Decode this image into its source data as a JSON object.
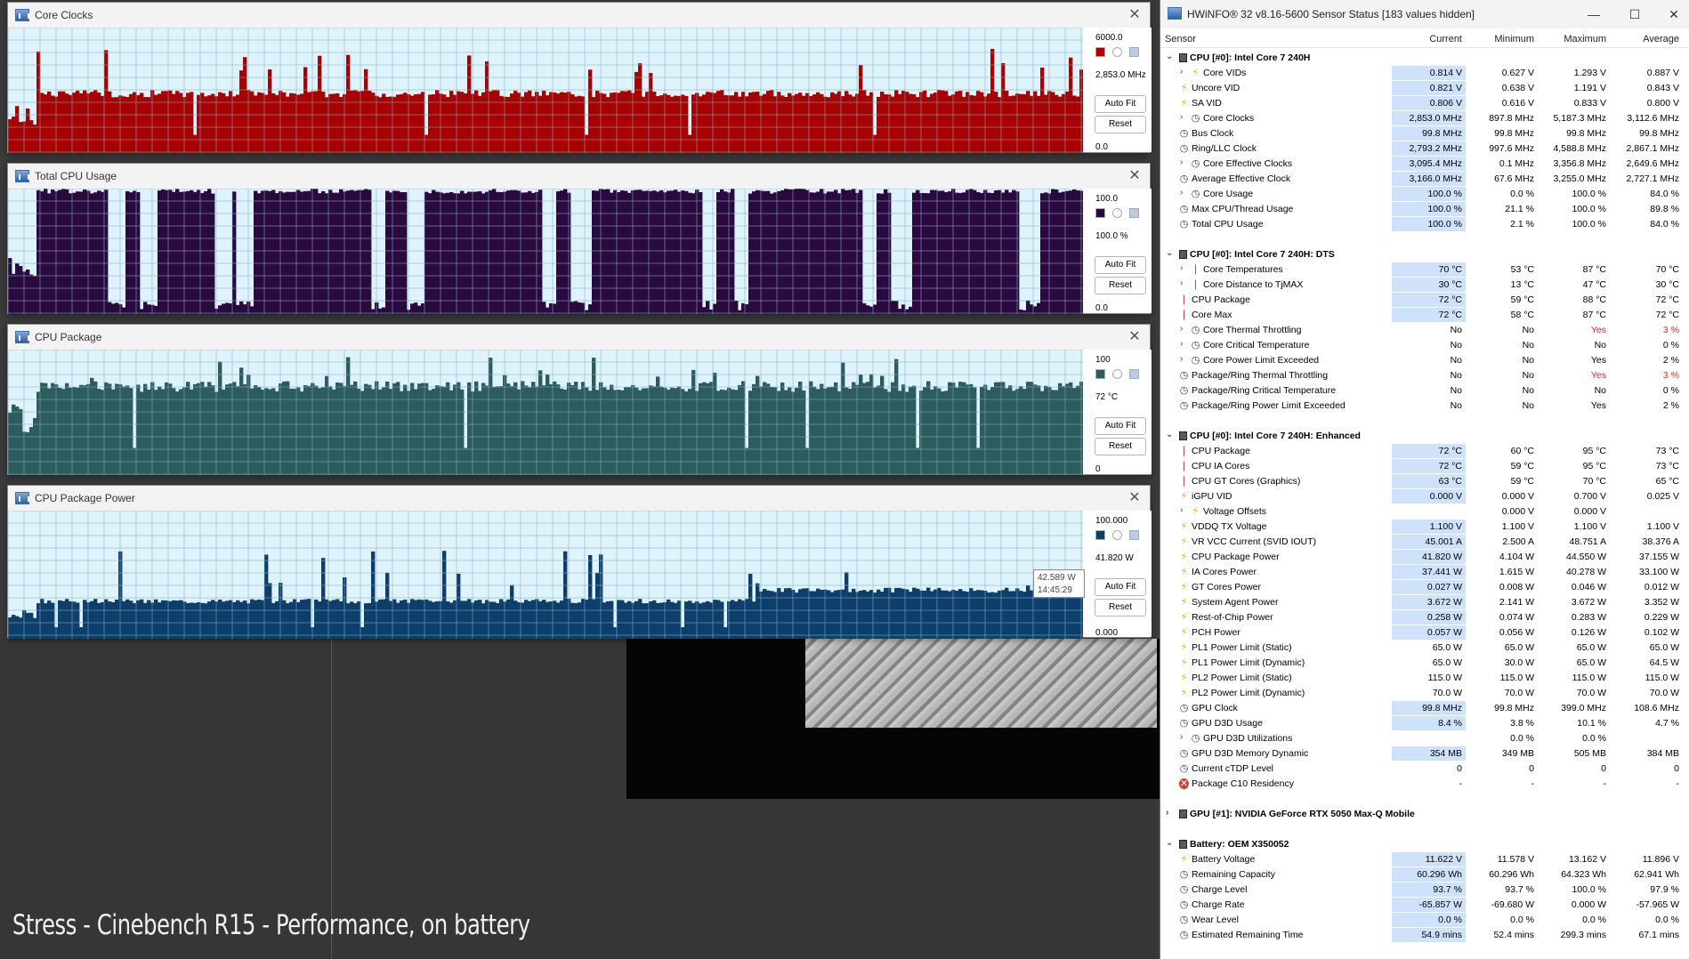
{
  "graph_windows": [
    {
      "title": "Core Clocks",
      "max_label": "6000.0",
      "current_label": "2,853.0 MHz",
      "min_label": "0.0",
      "color": "#a80000",
      "ymax": 6000,
      "baseline": 2900,
      "peaks": [
        4400,
        5000,
        4300,
        4200,
        5187
      ],
      "buttons": {
        "auto_fit": "Auto Fit",
        "reset": "Reset"
      }
    },
    {
      "title": "Total CPU Usage",
      "max_label": "100.0",
      "current_label": "100.0 %",
      "min_label": "0.0",
      "color": "#2a0a3e",
      "ymax": 100,
      "baseline": 98,
      "peaks": [
        100,
        100,
        100,
        100,
        100
      ],
      "buttons": {
        "auto_fit": "Auto Fit",
        "reset": "Reset"
      }
    },
    {
      "title": "CPU Package",
      "max_label": "100",
      "current_label": "72 °C",
      "min_label": "0",
      "color": "#2c5c5c",
      "ymax": 100,
      "baseline": 72,
      "peaks": [
        87,
        86,
        82,
        80,
        95
      ],
      "buttons": {
        "auto_fit": "Auto Fit",
        "reset": "Reset"
      }
    },
    {
      "title": "CPU Package Power",
      "max_label": "100.000",
      "current_label": "41.820 W",
      "min_label": "0.000",
      "color": "#0e3e6a",
      "ymax": 100,
      "baseline": 30,
      "peaks": [
        70,
        70,
        52,
        55,
        44.55
      ],
      "buttons": {
        "auto_fit": "Auto Fit",
        "reset": "Reset"
      }
    }
  ],
  "tooltip": {
    "value": "42.589 W",
    "time": "14:45:29"
  },
  "caption": "Stress - Cinebench R15 - Performance, on battery",
  "hwinfo": {
    "title": "HWiNFO® 32 v8.16-5600 Sensor Status [183 values hidden]",
    "window_buttons": {
      "minimize": "—",
      "maximize": "☐",
      "close": "✕"
    },
    "columns": [
      "Sensor",
      "Current",
      "Minimum",
      "Maximum",
      "Average"
    ],
    "groups": [
      {
        "name": "CPU [#0]: Intel Core 7 240H",
        "rows": [
          {
            "label": "Core VIDs",
            "icon": "bolt",
            "expand": true,
            "v": [
              "0.814 V",
              "0.627 V",
              "1.293 V",
              "0.887 V"
            ]
          },
          {
            "label": "Uncore VID",
            "icon": "bolt",
            "v": [
              "0.821 V",
              "0.638 V",
              "1.191 V",
              "0.843 V"
            ]
          },
          {
            "label": "SA VID",
            "icon": "bolt",
            "v": [
              "0.806 V",
              "0.616 V",
              "0.833 V",
              "0.800 V"
            ]
          },
          {
            "label": "Core Clocks",
            "icon": "clock",
            "expand": true,
            "v": [
              "2,853.0 MHz",
              "897.8 MHz",
              "5,187.3 MHz",
              "3,112.6 MHz"
            ]
          },
          {
            "label": "Bus Clock",
            "icon": "clock",
            "v": [
              "99.8 MHz",
              "99.8 MHz",
              "99.8 MHz",
              "99.8 MHz"
            ]
          },
          {
            "label": "Ring/LLC Clock",
            "icon": "clock",
            "v": [
              "2,793.2 MHz",
              "997.6 MHz",
              "4,588.8 MHz",
              "2,867.1 MHz"
            ]
          },
          {
            "label": "Core Effective Clocks",
            "icon": "clock",
            "expand": true,
            "v": [
              "3,095.4 MHz",
              "0.1 MHz",
              "3,356.8 MHz",
              "2,649.6 MHz"
            ]
          },
          {
            "label": "Average Effective Clock",
            "icon": "clock",
            "v": [
              "3,166.0 MHz",
              "67.6 MHz",
              "3,255.0 MHz",
              "2,727.1 MHz"
            ]
          },
          {
            "label": "Core Usage",
            "icon": "clock",
            "expand": true,
            "v": [
              "100.0 %",
              "0.0 %",
              "100.0 %",
              "84.0 %"
            ]
          },
          {
            "label": "Max CPU/Thread Usage",
            "icon": "clock",
            "v": [
              "100.0 %",
              "21.1 %",
              "100.0 %",
              "89.8 %"
            ]
          },
          {
            "label": "Total CPU Usage",
            "icon": "clock",
            "v": [
              "100.0 %",
              "2.1 %",
              "100.0 %",
              "84.0 %"
            ]
          }
        ]
      },
      {
        "name": "CPU [#0]: Intel Core 7 240H: DTS",
        "rows": [
          {
            "label": "Core Temperatures",
            "icon": "therm",
            "expand": true,
            "v": [
              "70 °C",
              "53 °C",
              "87 °C",
              "70 °C"
            ]
          },
          {
            "label": "Core Distance to TjMAX",
            "icon": "therm",
            "expand": true,
            "v": [
              "30 °C",
              "13 °C",
              "47 °C",
              "30 °C"
            ]
          },
          {
            "label": "CPU Package",
            "icon": "therm",
            "v": [
              "72 °C",
              "59 °C",
              "88 °C",
              "72 °C"
            ]
          },
          {
            "label": "Core Max",
            "icon": "therm",
            "v": [
              "72 °C",
              "58 °C",
              "87 °C",
              "72 °C"
            ]
          },
          {
            "label": "Core Thermal Throttling",
            "icon": "clock",
            "expand": true,
            "nohl": true,
            "red3": true,
            "red4": true,
            "v": [
              "No",
              "No",
              "Yes",
              "3 %"
            ]
          },
          {
            "label": "Core Critical Temperature",
            "icon": "clock",
            "expand": true,
            "nohl": true,
            "v": [
              "No",
              "No",
              "No",
              "0 %"
            ]
          },
          {
            "label": "Core Power Limit Exceeded",
            "icon": "clock",
            "expand": true,
            "nohl": true,
            "v": [
              "No",
              "No",
              "Yes",
              "2 %"
            ]
          },
          {
            "label": "Package/Ring Thermal Throttling",
            "icon": "clock",
            "nohl": true,
            "red3": true,
            "red4": true,
            "v": [
              "No",
              "No",
              "Yes",
              "3 %"
            ]
          },
          {
            "label": "Package/Ring Critical Temperature",
            "icon": "clock",
            "nohl": true,
            "v": [
              "No",
              "No",
              "No",
              "0 %"
            ]
          },
          {
            "label": "Package/Ring Power Limit Exceeded",
            "icon": "clock",
            "nohl": true,
            "v": [
              "No",
              "No",
              "Yes",
              "2 %"
            ]
          }
        ]
      },
      {
        "name": "CPU [#0]: Intel Core 7 240H: Enhanced",
        "rows": [
          {
            "label": "CPU Package",
            "icon": "therm",
            "v": [
              "72 °C",
              "60 °C",
              "95 °C",
              "73 °C"
            ]
          },
          {
            "label": "CPU IA Cores",
            "icon": "therm",
            "v": [
              "72 °C",
              "59 °C",
              "95 °C",
              "73 °C"
            ]
          },
          {
            "label": "CPU GT Cores (Graphics)",
            "icon": "therm",
            "v": [
              "63 °C",
              "59 °C",
              "70 °C",
              "65 °C"
            ]
          },
          {
            "label": "iGPU VID",
            "icon": "bolt",
            "v": [
              "0.000 V",
              "0.000 V",
              "0.700 V",
              "0.025 V"
            ]
          },
          {
            "label": "Voltage Offsets",
            "icon": "bolt",
            "expand": true,
            "nohl": true,
            "v": [
              "",
              "0.000 V",
              "0.000 V",
              ""
            ]
          },
          {
            "label": "VDDQ TX Voltage",
            "icon": "bolt",
            "v": [
              "1.100 V",
              "1.100 V",
              "1.100 V",
              "1.100 V"
            ]
          },
          {
            "label": "VR VCC Current (SVID IOUT)",
            "icon": "bolt",
            "v": [
              "45.001 A",
              "2.500 A",
              "48.751 A",
              "38.376 A"
            ]
          },
          {
            "label": "CPU Package Power",
            "icon": "bolt",
            "v": [
              "41.820 W",
              "4.104 W",
              "44.550 W",
              "37.155 W"
            ]
          },
          {
            "label": "IA Cores Power",
            "icon": "bolt",
            "v": [
              "37.441 W",
              "1.615 W",
              "40.278 W",
              "33.100 W"
            ]
          },
          {
            "label": "GT Cores Power",
            "icon": "bolt",
            "v": [
              "0.027 W",
              "0.008 W",
              "0.046 W",
              "0.012 W"
            ]
          },
          {
            "label": "System Agent Power",
            "icon": "bolt",
            "v": [
              "3.672 W",
              "2.141 W",
              "3.672 W",
              "3.352 W"
            ]
          },
          {
            "label": "Rest-of-Chip Power",
            "icon": "bolt",
            "v": [
              "0.258 W",
              "0.074 W",
              "0.283 W",
              "0.229 W"
            ]
          },
          {
            "label": "PCH Power",
            "icon": "bolt",
            "v": [
              "0.057 W",
              "0.056 W",
              "0.126 W",
              "0.102 W"
            ]
          },
          {
            "label": "PL1 Power Limit (Static)",
            "icon": "bolt",
            "nohl": true,
            "v": [
              "65.0 W",
              "65.0 W",
              "65.0 W",
              "65.0 W"
            ]
          },
          {
            "label": "PL1 Power Limit (Dynamic)",
            "icon": "bolt",
            "nohl": true,
            "v": [
              "65.0 W",
              "30.0 W",
              "65.0 W",
              "64.5 W"
            ]
          },
          {
            "label": "PL2 Power Limit (Static)",
            "icon": "bolt",
            "nohl": true,
            "v": [
              "115.0 W",
              "115.0 W",
              "115.0 W",
              "115.0 W"
            ]
          },
          {
            "label": "PL2 Power Limit (Dynamic)",
            "icon": "bolt",
            "nohl": true,
            "v": [
              "70.0 W",
              "70.0 W",
              "70.0 W",
              "70.0 W"
            ]
          },
          {
            "label": "GPU Clock",
            "icon": "clock",
            "v": [
              "99.8 MHz",
              "99.8 MHz",
              "399.0 MHz",
              "108.6 MHz"
            ]
          },
          {
            "label": "GPU D3D Usage",
            "icon": "clock",
            "v": [
              "8.4 %",
              "3.8 %",
              "10.1 %",
              "4.7 %"
            ]
          },
          {
            "label": "GPU D3D Utilizations",
            "icon": "clock",
            "expand": true,
            "nohl": true,
            "v": [
              "",
              "0.0 %",
              "0.0 %",
              ""
            ]
          },
          {
            "label": "GPU D3D Memory Dynamic",
            "icon": "clock",
            "v": [
              "354 MB",
              "349 MB",
              "505 MB",
              "384 MB"
            ]
          },
          {
            "label": "Current cTDP Level",
            "icon": "clock",
            "nohl": true,
            "v": [
              "0",
              "0",
              "0",
              "0"
            ]
          },
          {
            "label": "Package C10 Residency",
            "icon": "x",
            "nohl": true,
            "v": [
              "-",
              "-",
              "-",
              "-"
            ]
          }
        ]
      },
      {
        "name": "GPU [#1]: NVIDIA  GeForce RTX 5050 Max-Q Mobile",
        "collapsed": true,
        "rows": []
      },
      {
        "name": "Battery: OEM X350052",
        "rows": [
          {
            "label": "Battery Voltage",
            "icon": "bolt",
            "v": [
              "11.622 V",
              "11.578 V",
              "13.162 V",
              "11.896 V"
            ]
          },
          {
            "label": "Remaining Capacity",
            "icon": "clock",
            "v": [
              "60.296 Wh",
              "60.296 Wh",
              "64.323 Wh",
              "62.941 Wh"
            ]
          },
          {
            "label": "Charge Level",
            "icon": "clock",
            "v": [
              "93.7 %",
              "93.7 %",
              "100.0 %",
              "97.9 %"
            ]
          },
          {
            "label": "Charge Rate",
            "icon": "clock",
            "v": [
              "-65.857 W",
              "-69.680 W",
              "0.000 W",
              "-57.965 W"
            ]
          },
          {
            "label": "Wear Level",
            "icon": "clock",
            "v": [
              "0.0 %",
              "0.0 %",
              "0.0 %",
              "0.0 %"
            ]
          },
          {
            "label": "Estimated Remaining Time",
            "icon": "clock",
            "v": [
              "54.9 mins",
              "52.4 mins",
              "299.3 mins",
              "67.1 mins"
            ]
          }
        ]
      }
    ]
  }
}
